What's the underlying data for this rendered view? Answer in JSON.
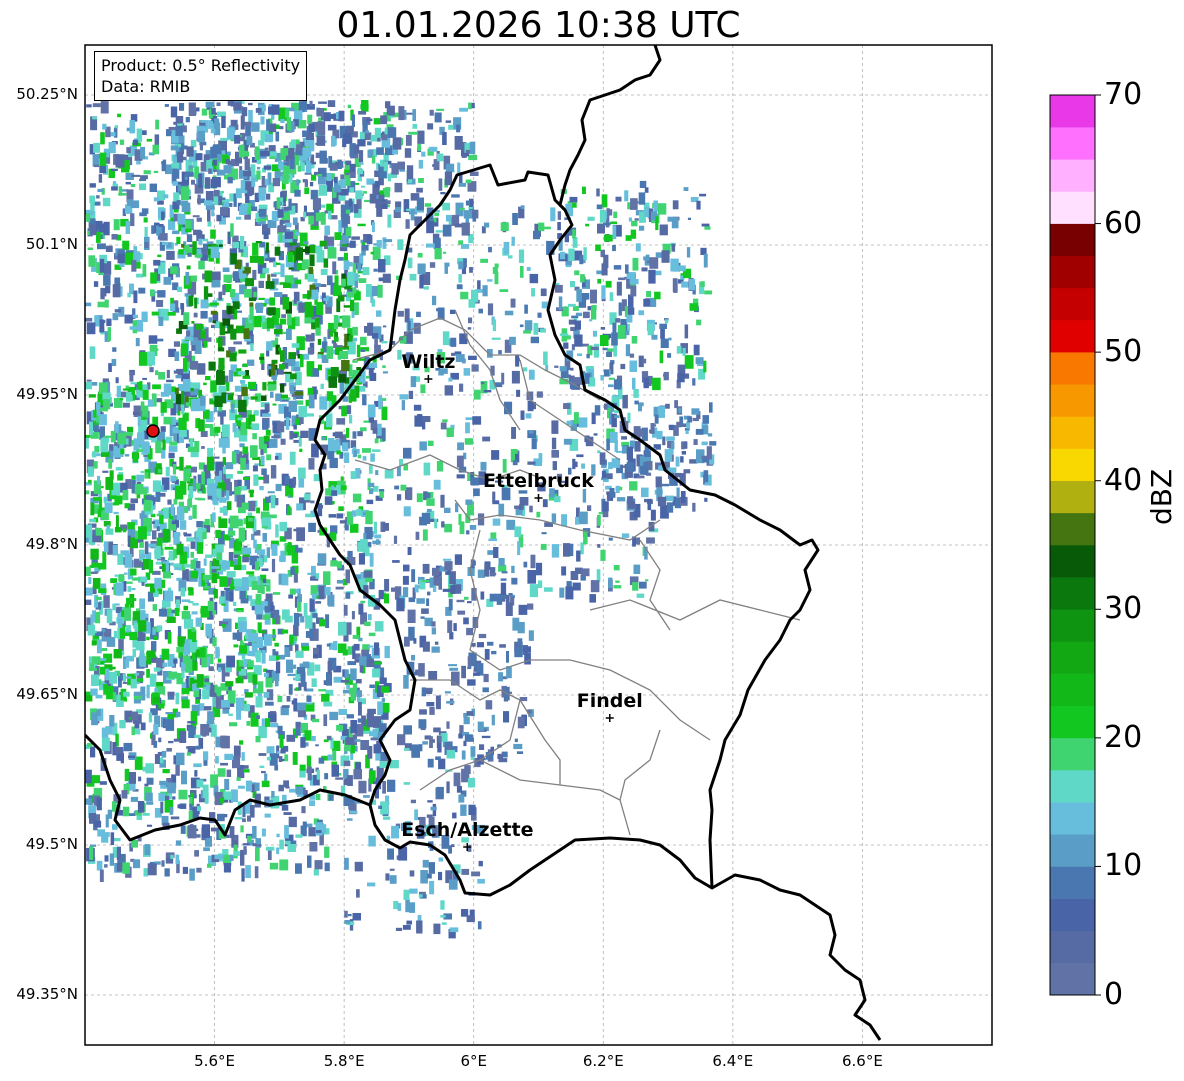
{
  "title": "01.01.2026 10:38 UTC",
  "info_box": {
    "line1": "Product: 0.5° Reflectivity",
    "line2": "Data: RMIB"
  },
  "map": {
    "lon_ticks": [
      "5.6°E",
      "5.8°E",
      "6°E",
      "6.2°E",
      "6.4°E",
      "6.6°E"
    ],
    "lat_ticks": [
      "50.25°N",
      "50.1°N",
      "49.95°N",
      "49.8°N",
      "49.65°N",
      "49.5°N",
      "49.35°N"
    ],
    "cities": [
      {
        "name": "Wiltz",
        "lon": 5.93,
        "lat": 49.966
      },
      {
        "name": "Ettelbruck",
        "lon": 6.1,
        "lat": 49.847
      },
      {
        "name": "Findel",
        "lon": 6.21,
        "lat": 49.627
      },
      {
        "name": "Esch/Alzette",
        "lon": 5.99,
        "lat": 49.498
      }
    ],
    "radar_site": {
      "lon": 5.505,
      "lat": 49.914
    },
    "colors": {
      "border": "#000000",
      "cantons": "#808080",
      "grid": "#b0b0b0",
      "radar_site": "#dd1111"
    }
  },
  "colorbar": {
    "label": "dBZ",
    "ticks": [
      "0",
      "10",
      "20",
      "30",
      "40",
      "50",
      "60",
      "70"
    ],
    "colors": [
      "#6173a6",
      "#566aa3",
      "#4a64a8",
      "#4a77b0",
      "#5a9ec8",
      "#67bedc",
      "#60d8c8",
      "#40d470",
      "#12c820",
      "#12b818",
      "#12a814",
      "#0e9410",
      "#0a780c",
      "#085a08",
      "#457510",
      "#b0b010",
      "#f8d800",
      "#f8b800",
      "#f89800",
      "#f87800",
      "#e00000",
      "#c40000",
      "#a00000",
      "#780000",
      "#ffe0ff",
      "#ffb0ff",
      "#ff70ff",
      "#e838e8"
    ]
  }
}
